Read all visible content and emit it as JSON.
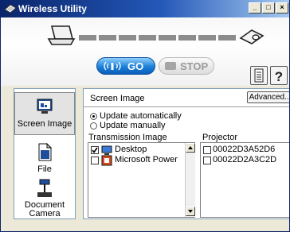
{
  "window": {
    "title": "Wireless Utility",
    "minimize": "_",
    "maximize": "□",
    "close": "×"
  },
  "toolbar": {
    "go_label": "GO",
    "stop_label": "STOP",
    "go_icon": "wireless-signal-icon"
  },
  "sidebar": {
    "items": [
      {
        "label": "Screen Image",
        "icon": "screen-image-icon",
        "selected": true
      },
      {
        "label": "File",
        "icon": "file-icon",
        "selected": false
      },
      {
        "label": "Document",
        "label2": "Camera",
        "icon": "document-camera-icon",
        "selected": false
      }
    ]
  },
  "main": {
    "title": "Screen Image",
    "advanced_label": "Advanced...",
    "radios": [
      {
        "label": "Update automatically",
        "checked": true
      },
      {
        "label": "Update manually",
        "checked": false
      }
    ],
    "transmission": {
      "label": "Transmission Image",
      "items": [
        {
          "label": "Desktop",
          "checked": true,
          "icon": "desktop-icon"
        },
        {
          "label": "Microsoft Power",
          "checked": false,
          "icon": "powerpoint-icon"
        }
      ]
    },
    "projector": {
      "label": "Projector",
      "items": [
        {
          "label": "00022D3A52D6",
          "checked": false
        },
        {
          "label": "00022D2A3C2D",
          "checked": false
        }
      ]
    }
  },
  "colors": {
    "go_blue": "#1b7fd8",
    "titlebar_dark": "#0a246a",
    "titlebar_light": "#a6caf0"
  }
}
